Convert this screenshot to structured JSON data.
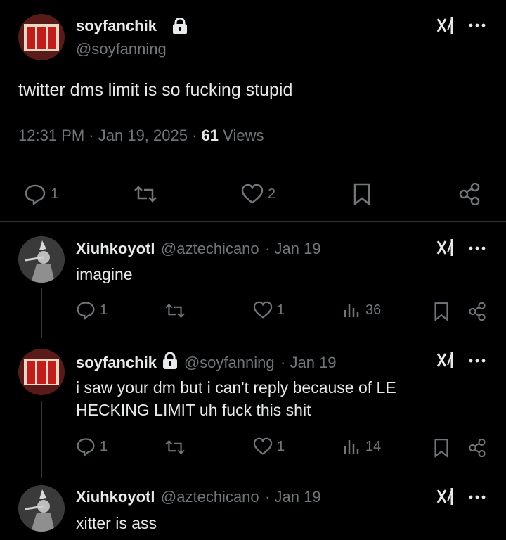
{
  "main_tweet": {
    "display_name": "soyfanchik",
    "handle": "@soyfanning",
    "text": "twitter dms limit is so fucking stupid",
    "time": "12:31 PM",
    "separator": "·",
    "date": "Jan 19, 2025",
    "views_count": "61",
    "views_label": "Views",
    "replies": "1",
    "likes": "2"
  },
  "replies": [
    {
      "display_name": "Xiuhkoyotl",
      "handle": "@aztechicano",
      "date": "· Jan 19",
      "text": "imagine",
      "replies": "1",
      "likes": "1",
      "views": "36"
    },
    {
      "display_name": "soyfanchik",
      "handle": "@soyfanning",
      "date": "· Jan 19",
      "text_line1": "i saw your dm but i can't reply because of LE",
      "text_line2": "HECKING LIMIT uh fuck this shit",
      "replies": "1",
      "likes": "1",
      "views": "14"
    },
    {
      "display_name": "Xiuhkoyotl",
      "handle": "@aztechicano",
      "date": "· Jan 19",
      "text": "xitter is ass"
    }
  ],
  "colors": {
    "background": "#000000",
    "text": "#e7e9ea",
    "muted": "#71767b",
    "divider": "#2f3336"
  }
}
